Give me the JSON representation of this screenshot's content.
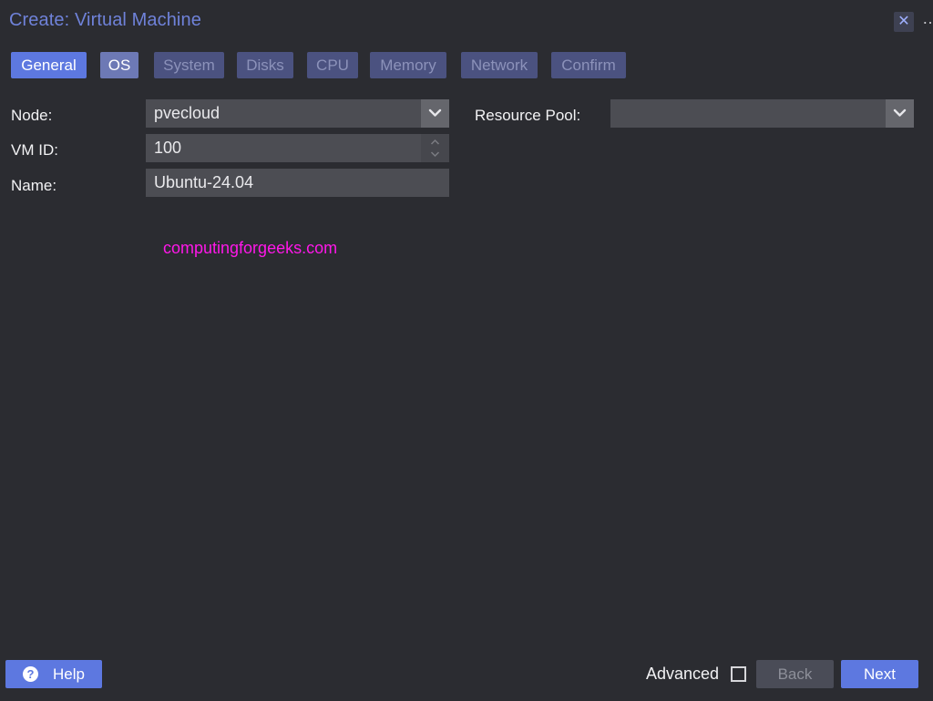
{
  "window": {
    "title": "Create: Virtual Machine",
    "close_glyph": "✕",
    "more_glyph": "…"
  },
  "tabs": [
    {
      "label": "General",
      "state": "active"
    },
    {
      "label": "OS",
      "state": "enabled"
    },
    {
      "label": "System",
      "state": "disabled"
    },
    {
      "label": "Disks",
      "state": "disabled"
    },
    {
      "label": "CPU",
      "state": "disabled"
    },
    {
      "label": "Memory",
      "state": "disabled"
    },
    {
      "label": "Network",
      "state": "disabled"
    },
    {
      "label": "Confirm",
      "state": "disabled"
    }
  ],
  "form": {
    "node": {
      "label": "Node:",
      "value": "pvecloud"
    },
    "vmid": {
      "label": "VM ID:",
      "value": "100"
    },
    "name": {
      "label": "Name:",
      "value": "Ubuntu-24.04"
    },
    "resource_pool": {
      "label": "Resource Pool:",
      "value": ""
    }
  },
  "watermark": "computingforgeeks.com",
  "footer": {
    "help_label": "Help",
    "help_glyph": "?",
    "advanced_label": "Advanced",
    "advanced_checked": false,
    "back_label": "Back",
    "next_label": "Next"
  },
  "colors": {
    "background": "#2b2c31",
    "accent": "#5d78e0",
    "title": "#6f82d9",
    "field": "#4c4d53",
    "watermark": "#ff17e9"
  },
  "icons": {
    "close": "close-icon",
    "help": "help-circle-icon",
    "dropdown": "chevron-down-icon",
    "spinner": "spinner-arrows-icon"
  }
}
